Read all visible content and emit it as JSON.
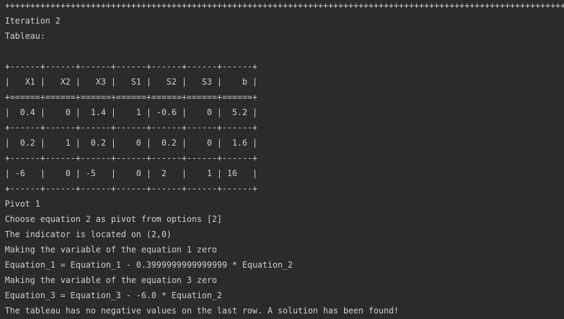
{
  "console": {
    "lines": [
      "++++++++++++++++++++++++++++++++++++++++++++++++++++++++++++++++++++++++++++++++++++++++++++++++++++++++++++++++",
      "Iteration 2",
      "Tableau:",
      "",
      "+------+------+------+------+------+------+------+",
      "|   X1 |   X2 |   X3 |   S1 |   S2 |   S3 |    b |",
      "+======+======+======+======+======+======+======+",
      "|  0.4 |    0 |  1.4 |    1 | -0.6 |    0 |  5.2 |",
      "+------+------+------+------+------+------+------+",
      "|  0.2 |    1 |  0.2 |    0 |  0.2 |    0 |  1.6 |",
      "+------+------+------+------+------+------+------+",
      "| -6   |    0 | -5   |    0 |  2   |    1 | 16   |",
      "+------+------+------+------+------+------+------+",
      "Pivot 1",
      "Choose equation 2 as pivot from options [2]",
      "The indicator is located on (2,0)",
      "Making the variable of the equation 1 zero",
      "Equation_1 = Equation_1 - 0.3999999999999999 * Equation_2",
      "Making the variable of the equation 3 zero",
      "Equation_3 = Equation_3 - -6.0 * Equation_2",
      "The tableau has no negative values on the last row. A solution has been found!"
    ]
  },
  "colors": {
    "background": "#2b2b2b",
    "text": "#cfcfcf"
  }
}
